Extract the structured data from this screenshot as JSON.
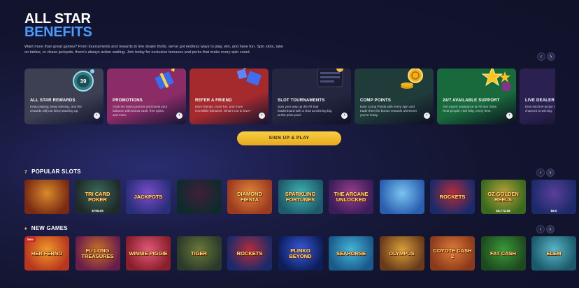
{
  "hero": {
    "title_line1": "ALL STAR",
    "title_line2": "BENEFITS",
    "description": "Want more than great games? From tournaments and rewards to live dealer thrills, we've got endless ways to play, win, and have fun. Spin slots, take on tables, or chase jackpots, there's always action waiting. Join today for exclusive bonuses and perks that make every spin count."
  },
  "benefits": {
    "prev_label": "‹",
    "next_label": "›",
    "cards": [
      {
        "title": "ALL STAR REWARDS",
        "text": "Keep playing, keep winning, and the rewards will just keep stacking up.",
        "icon": "rewards-badge-icon",
        "bg": "#3d3f53",
        "badge_text": "39"
      },
      {
        "title": "PROMOTIONS",
        "text": "Grab the latest promos and boost your balance with bonus cash, free spins, and more.",
        "icon": "gift-box-icon",
        "bg": "#8b2c66"
      },
      {
        "title": "REFER A FRIEND",
        "text": "More friends, more fun, and more incredible bonuses. What's not to love?",
        "icon": "friends-gift-icon",
        "bg": "#a52a2e"
      },
      {
        "title": "SLOT TOURNAMENTS",
        "text": "Spin your way up the All Star leaderboard with a shot at winning big at the prize pool.",
        "icon": "leaderboard-icon",
        "bg": "#242640"
      },
      {
        "title": "COMP POINTS",
        "text": "Earn Comp Points with every spin and trade them for bonus rewards whenever you're ready.",
        "icon": "coins-icon",
        "bg": "#1f3b3a"
      },
      {
        "title": "24/7 AVAILABLE SUPPORT",
        "text": "Get expert assistance at All Star Slots. Real people, real help, every time.",
        "icon": "stars-support-icon",
        "bg": "#186a3c"
      },
      {
        "title": "LIVE DEALER",
        "text": "Dive into live-action real dealers, real chances to win big.",
        "icon": "dealer-icon",
        "bg": "#2a2150"
      }
    ]
  },
  "cta": {
    "label": "SIGN UP & PLAY"
  },
  "popular": {
    "heading": "POPULAR SLOTS",
    "icon_glyph": "7",
    "prev_label": "‹",
    "next_label": "›",
    "games": [
      {
        "name": "",
        "jackpot": "",
        "color1": "#7a2a12",
        "color2": "#d98a2a"
      },
      {
        "name": "Tri Card Poker",
        "jackpot": "$798.05",
        "color1": "#1e2a2a",
        "color2": "#3c6b5a"
      },
      {
        "name": "Jackpots",
        "jackpot": "",
        "color1": "#2a2f7a",
        "color2": "#7a4bc9"
      },
      {
        "name": "",
        "jackpot": "",
        "color1": "#0f2a2c",
        "color2": "#3f1f3a"
      },
      {
        "name": "Diamond Fiesta",
        "jackpot": "",
        "color1": "#9b3a1e",
        "color2": "#e2863a"
      },
      {
        "name": "Sparkling Fortunes",
        "jackpot": "",
        "color1": "#1d5a6a",
        "color2": "#3fb3b1"
      },
      {
        "name": "The Arcane Unlocked",
        "jackpot": "",
        "color1": "#3a1d5a",
        "color2": "#9a3e8a"
      },
      {
        "name": "",
        "jackpot": "",
        "color1": "#2a5fb0",
        "color2": "#7ac3f0"
      },
      {
        "name": "Rockets",
        "jackpot": "",
        "color1": "#1b2a6a",
        "color2": "#b52c3a"
      },
      {
        "name": "Oz Golden Reels",
        "jackpot": "$8,772.08",
        "color1": "#3a6a1d",
        "color2": "#b8a23a"
      },
      {
        "name": "",
        "jackpot": "$8.0",
        "color1": "#1c2a6a",
        "color2": "#5a3f9a"
      }
    ]
  },
  "newgames": {
    "heading": "NEW GAMES",
    "icon_glyph": "♦",
    "prev_label": "‹",
    "next_label": "›",
    "games": [
      {
        "name": "Hen Ferno",
        "badge": "New",
        "color1": "#b8351e",
        "color2": "#f09a2a"
      },
      {
        "name": "Fu Long Treasures",
        "badge": "",
        "color1": "#6a1d4a",
        "color2": "#c9712a"
      },
      {
        "name": "Winnie Piggie",
        "badge": "",
        "color1": "#8a1e2a",
        "color2": "#e05a7a"
      },
      {
        "name": "Tiger",
        "badge": "",
        "color1": "#2a3a2a",
        "color2": "#6a7a3a"
      },
      {
        "name": "Rockets",
        "badge": "",
        "color1": "#1b2a6a",
        "color2": "#b52c3a"
      },
      {
        "name": "Plinko Beyond",
        "badge": "",
        "color1": "#0d1e5a",
        "color2": "#3a5ae0"
      },
      {
        "name": "Seahorse",
        "badge": "",
        "color1": "#1a5a8a",
        "color2": "#45b6d9"
      },
      {
        "name": "Olympus",
        "badge": "",
        "color1": "#6a3a1a",
        "color2": "#d9a03a"
      },
      {
        "name": "Coyote Cash 2",
        "badge": "",
        "color1": "#8a3a1a",
        "color2": "#e07a3a"
      },
      {
        "name": "Fat Cash",
        "badge": "",
        "color1": "#1d4a1d",
        "color2": "#3a9a3a"
      },
      {
        "name": "Elem",
        "badge": "",
        "color1": "#1a5a6a",
        "color2": "#5ab6c9"
      }
    ]
  }
}
